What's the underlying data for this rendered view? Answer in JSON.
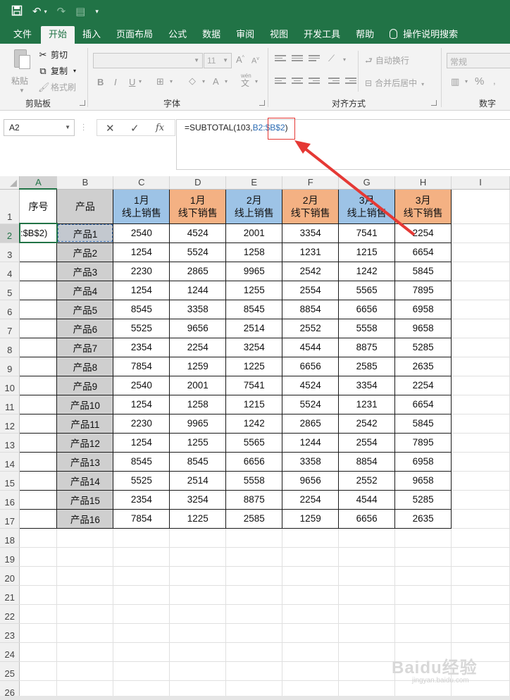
{
  "qat": {
    "save_icon": "save-icon",
    "undo_icon": "undo-icon",
    "redo_icon": "redo-icon",
    "customize_icon": "customize-icon"
  },
  "tabs": [
    {
      "label": "文件"
    },
    {
      "label": "开始"
    },
    {
      "label": "插入"
    },
    {
      "label": "页面布局"
    },
    {
      "label": "公式"
    },
    {
      "label": "数据"
    },
    {
      "label": "审阅"
    },
    {
      "label": "视图"
    },
    {
      "label": "开发工具"
    },
    {
      "label": "帮助"
    },
    {
      "label": "操作说明搜索"
    }
  ],
  "ribbon": {
    "paste": "粘贴",
    "cut": "剪切",
    "copy": "复制",
    "format_painter": "格式刷",
    "clipboard_group": "剪贴板",
    "font_group": "字体",
    "font_size": "11",
    "font_size_grow": "A",
    "font_size_shrink": "A",
    "bold": "B",
    "italic": "I",
    "underline": "U",
    "wen": "wén",
    "wen_char": "文",
    "wrap_text": "自动换行",
    "merge_center": "合并后居中",
    "align_group": "对齐方式",
    "number_format": "常规",
    "number_group": "数字",
    "percent": "%"
  },
  "formula_bar": {
    "name_box": "A2",
    "cancel": "✕",
    "enter": "✓",
    "fx": "fx",
    "formula_prefix": "=SUBTOTAL(103,",
    "formula_ref1": "B2:",
    "formula_ref2": "$B$2",
    "formula_suffix": ")"
  },
  "columns": [
    "A",
    "B",
    "C",
    "D",
    "E",
    "F",
    "G",
    "H",
    "I"
  ],
  "header_row": {
    "a": "序号",
    "b": "产品",
    "c1": "1月",
    "c2": "线上销售",
    "d1": "1月",
    "d2": "线下销售",
    "e1": "2月",
    "e2": "线上销售",
    "f1": "2月",
    "f2": "线下销售",
    "g1": "3月",
    "g2": "线上销售",
    "h1": "3月",
    "h2": "线下销售"
  },
  "active_cell_text": ":$B$2)",
  "rows": [
    {
      "num": "2",
      "p": "产品1",
      "v": [
        "2540",
        "4524",
        "2001",
        "3354",
        "7541",
        "2254"
      ]
    },
    {
      "num": "3",
      "p": "产品2",
      "v": [
        "1254",
        "5524",
        "1258",
        "1231",
        "1215",
        "6654"
      ]
    },
    {
      "num": "4",
      "p": "产品3",
      "v": [
        "2230",
        "2865",
        "9965",
        "2542",
        "1242",
        "5845"
      ]
    },
    {
      "num": "5",
      "p": "产品4",
      "v": [
        "1254",
        "1244",
        "1255",
        "2554",
        "5565",
        "7895"
      ]
    },
    {
      "num": "6",
      "p": "产品5",
      "v": [
        "8545",
        "3358",
        "8545",
        "8854",
        "6656",
        "6958"
      ]
    },
    {
      "num": "7",
      "p": "产品6",
      "v": [
        "5525",
        "9656",
        "2514",
        "2552",
        "5558",
        "9658"
      ]
    },
    {
      "num": "8",
      "p": "产品7",
      "v": [
        "2354",
        "2254",
        "3254",
        "4544",
        "8875",
        "5285"
      ]
    },
    {
      "num": "9",
      "p": "产品8",
      "v": [
        "7854",
        "1259",
        "1225",
        "6656",
        "2585",
        "2635"
      ]
    },
    {
      "num": "10",
      "p": "产品9",
      "v": [
        "2540",
        "2001",
        "7541",
        "4524",
        "3354",
        "2254"
      ]
    },
    {
      "num": "11",
      "p": "产品10",
      "v": [
        "1254",
        "1258",
        "1215",
        "5524",
        "1231",
        "6654"
      ]
    },
    {
      "num": "12",
      "p": "产品11",
      "v": [
        "2230",
        "9965",
        "1242",
        "2865",
        "2542",
        "5845"
      ]
    },
    {
      "num": "13",
      "p": "产品12",
      "v": [
        "1254",
        "1255",
        "5565",
        "1244",
        "2554",
        "7895"
      ]
    },
    {
      "num": "14",
      "p": "产品13",
      "v": [
        "8545",
        "8545",
        "6656",
        "3358",
        "8854",
        "6958"
      ]
    },
    {
      "num": "15",
      "p": "产品14",
      "v": [
        "5525",
        "2514",
        "5558",
        "9656",
        "2552",
        "9658"
      ]
    },
    {
      "num": "16",
      "p": "产品15",
      "v": [
        "2354",
        "3254",
        "8875",
        "2254",
        "4544",
        "5285"
      ]
    },
    {
      "num": "17",
      "p": "产品16",
      "v": [
        "7854",
        "1225",
        "2585",
        "1259",
        "6656",
        "2635"
      ]
    }
  ],
  "empty_rows": [
    "18",
    "19",
    "20",
    "21",
    "22",
    "23",
    "24",
    "25",
    "26"
  ],
  "colors": {
    "accent": "#217346",
    "online": "#9dc3e6",
    "offline": "#f4b183",
    "product": "#cfcfcf",
    "annotation": "#e53935"
  },
  "watermark": "Baidu经验",
  "watermark_sub": "jingyan.baidu.com"
}
